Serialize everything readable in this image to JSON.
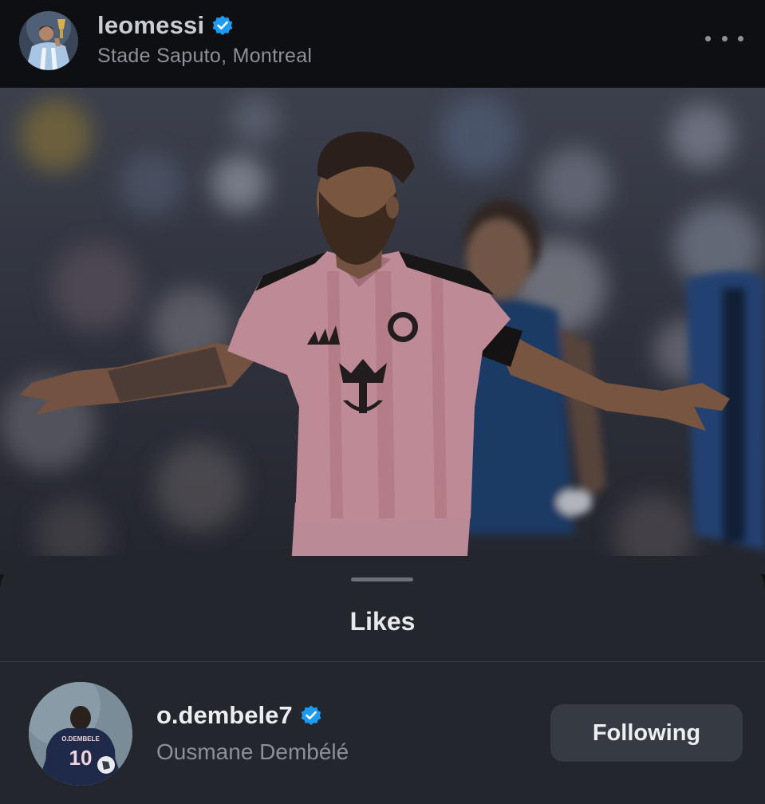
{
  "post": {
    "username": "leomessi",
    "location": "Stade Saputo, Montreal",
    "verified": true,
    "more_icon": "more-horizontal-icon"
  },
  "likes_sheet": {
    "title": "Likes",
    "likers": [
      {
        "username": "o.dembele7",
        "full_name": "Ousmane Dembélé",
        "verified": true,
        "button_label": "Following",
        "avatar_jersey_name": "O.DEMBELE",
        "avatar_jersey_number": "10"
      }
    ]
  },
  "colors": {
    "verified_badge": "#1d9bf0",
    "sheet_background": "#23262d",
    "button_background": "#363a43",
    "jersey_pink": "#e8a9b8"
  }
}
